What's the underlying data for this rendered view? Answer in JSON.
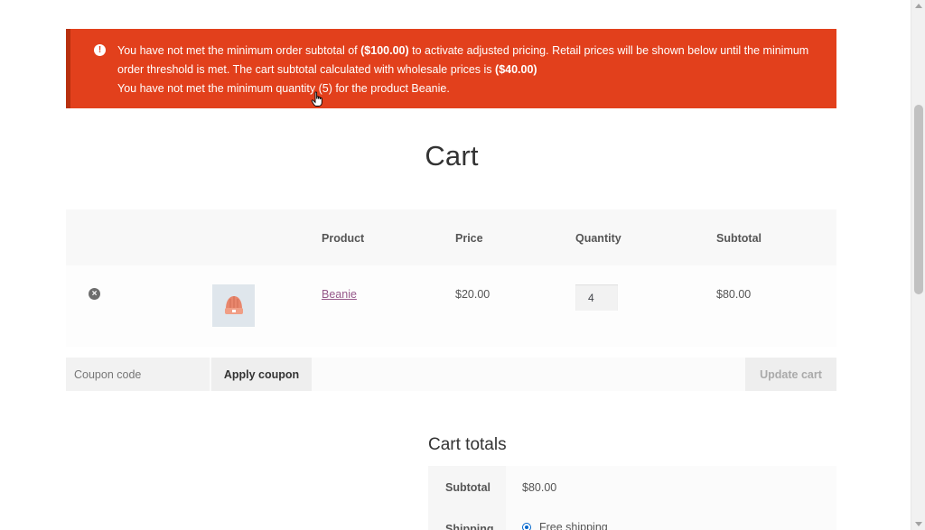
{
  "notice": {
    "line1_prefix": "You have not met the minimum order subtotal of ",
    "min_subtotal": "($100.00)",
    "line1_suffix": " to activate adjusted pricing. Retail prices will be shown below until the minimum",
    "line2_prefix": "order threshold is met. The cart subtotal calculated with wholesale prices is ",
    "wholesale_subtotal": "($40.00)",
    "line3": "You have not met the minimum quantity (5) for the product Beanie.",
    "icon": "exclamation-icon"
  },
  "page": {
    "title": "Cart"
  },
  "cart": {
    "headers": {
      "product": "Product",
      "price": "Price",
      "quantity": "Quantity",
      "subtotal": "Subtotal"
    },
    "items": [
      {
        "name": "Beanie",
        "price": "$20.00",
        "quantity": "4",
        "subtotal": "$80.00"
      }
    ],
    "coupon": {
      "placeholder": "Coupon code",
      "apply_label": "Apply coupon"
    },
    "update_label": "Update cart"
  },
  "totals": {
    "title": "Cart totals",
    "subtotal_label": "Subtotal",
    "subtotal_value": "$80.00",
    "shipping_label": "Shipping",
    "shipping_option": "Free shipping"
  },
  "colors": {
    "notice_bg": "#e2401c",
    "link": "#96588a",
    "radio": "#0066cc"
  }
}
